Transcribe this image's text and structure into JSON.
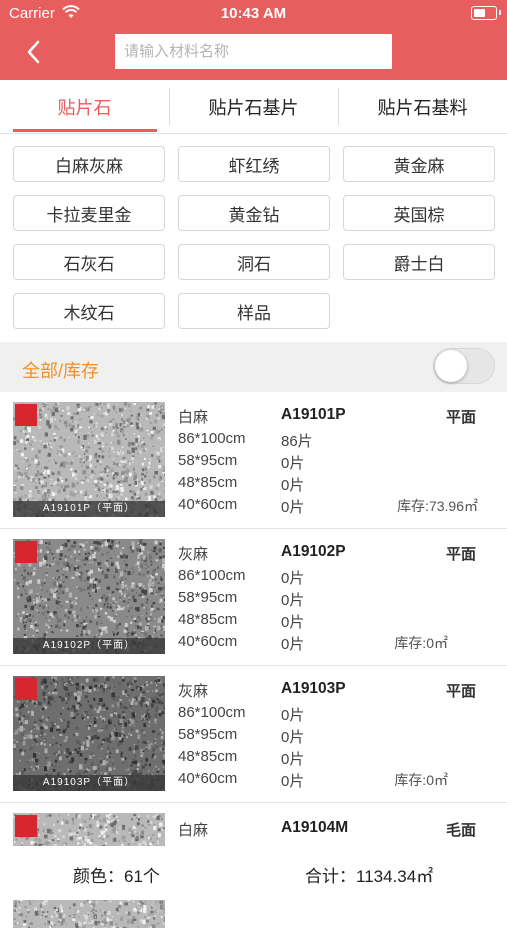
{
  "status_bar": {
    "carrier": "Carrier",
    "time": "10:43 AM"
  },
  "colors": {
    "header": "#e85d5d",
    "accent": "#e85d5d",
    "filter": "#f39020"
  },
  "search": {
    "placeholder": "请输入材料名称"
  },
  "tabs": [
    {
      "label": "贴片石",
      "active": true
    },
    {
      "label": "贴片石基片",
      "active": false
    },
    {
      "label": "贴片石基料",
      "active": false
    }
  ],
  "categories": [
    "白麻灰麻",
    "虾红绣",
    "黄金麻",
    "卡拉麦里金",
    "黄金钻",
    "英国棕",
    "石灰石",
    "洞石",
    "爵士白",
    "木纹石",
    "样品"
  ],
  "filter": {
    "label": "全部/库存",
    "toggle_on": false
  },
  "items": [
    {
      "name": "白麻",
      "code": "A19101P",
      "finish": "平面",
      "sizes": [
        {
          "size": "86*100cm",
          "qty": "86片"
        },
        {
          "size": "58*95cm",
          "qty": "0片"
        },
        {
          "size": "48*85cm",
          "qty": "0片"
        },
        {
          "size": "40*60cm",
          "qty": "0片"
        }
      ],
      "stock": "库存:73.96㎡",
      "caption": "A19101P（平面）",
      "tone": "light"
    },
    {
      "name": "灰麻",
      "code": "A19102P",
      "finish": "平面",
      "sizes": [
        {
          "size": "86*100cm",
          "qty": "0片"
        },
        {
          "size": "58*95cm",
          "qty": "0片"
        },
        {
          "size": "48*85cm",
          "qty": "0片"
        },
        {
          "size": "40*60cm",
          "qty": "0片"
        }
      ],
      "stock": "库存:0㎡",
      "caption": "A19102P（平面）",
      "tone": "mid"
    },
    {
      "name": "灰麻",
      "code": "A19103P",
      "finish": "平面",
      "sizes": [
        {
          "size": "86*100cm",
          "qty": "0片"
        },
        {
          "size": "58*95cm",
          "qty": "0片"
        },
        {
          "size": "48*85cm",
          "qty": "0片"
        },
        {
          "size": "40*60cm",
          "qty": "0片"
        }
      ],
      "stock": "库存:0㎡",
      "caption": "A19103P（平面）",
      "tone": "dark"
    },
    {
      "name": "白麻",
      "code": "A19104M",
      "finish": "毛面",
      "sizes": [],
      "stock": "",
      "caption": "",
      "tone": "light"
    }
  ],
  "footer": {
    "color_count": "颜色：61个",
    "total": "合计：1134.34㎡"
  }
}
